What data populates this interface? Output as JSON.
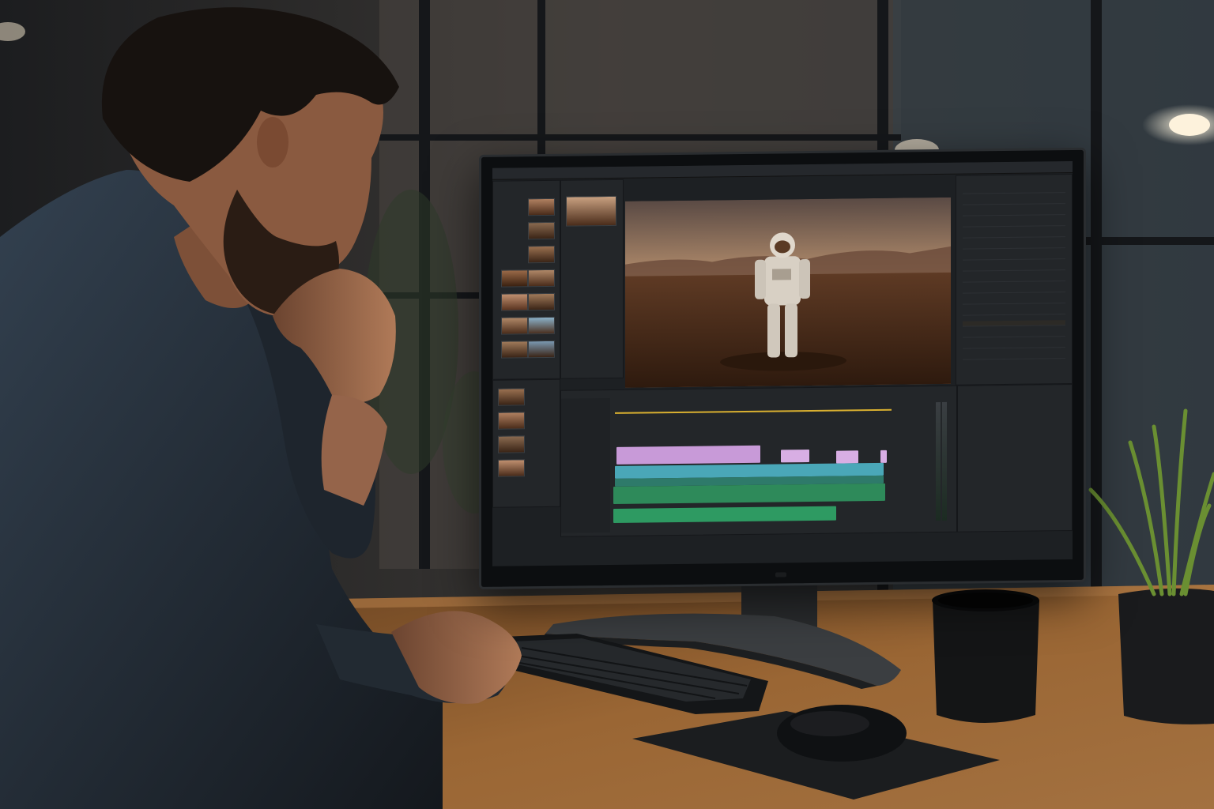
{
  "scene": {
    "description_colors": {
      "wall": "#2a2826",
      "desk": "#8a5a2e",
      "shirt": "#2a3440",
      "screen_bg": "#1d2023",
      "video_sky": "#c89a72",
      "video_ground": "#4a2a18",
      "clip_purple": "#c89ad8",
      "clip_teal": "#4aa7b8",
      "clip_green": "#2e8a5a",
      "playhead": "#d9b030"
    }
  },
  "editor": {
    "icons": [
      "play-icon",
      "step-back-icon",
      "step-forward-icon",
      "loop-icon",
      "marker-icon",
      "wrench-icon"
    ]
  }
}
